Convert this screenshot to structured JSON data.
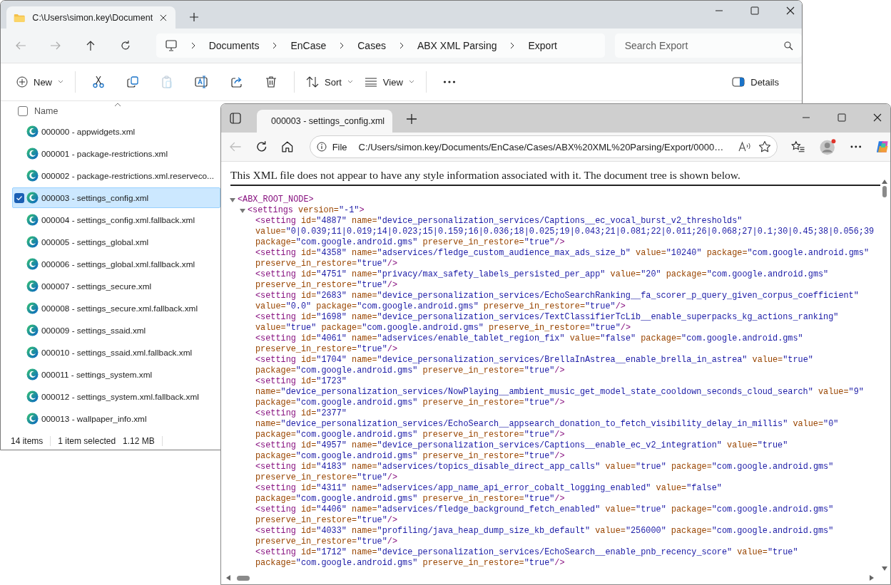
{
  "explorer": {
    "tab_title": "C:\\Users\\simon.key\\Document",
    "breadcrumb": [
      "Documents",
      "EnCase",
      "Cases",
      "ABX XML Parsing",
      "Export"
    ],
    "search": {
      "placeholder": "Search Export"
    },
    "toolbar": {
      "new": "New",
      "sort": "Sort",
      "view": "View",
      "details": "Details"
    },
    "column": "Name",
    "select_all": {
      "checked": false
    },
    "files": [
      {
        "name": "000000 - appwidgets.xml",
        "selected": false
      },
      {
        "name": "000001 - package-restrictions.xml",
        "selected": false
      },
      {
        "name": "000002 - package-restrictions.xml.reserveco...",
        "selected": false
      },
      {
        "name": "000003 - settings_config.xml",
        "selected": true
      },
      {
        "name": "000004 - settings_config.xml.fallback.xml",
        "selected": false
      },
      {
        "name": "000005 - settings_global.xml",
        "selected": false
      },
      {
        "name": "000006 - settings_global.xml.fallback.xml",
        "selected": false
      },
      {
        "name": "000007 - settings_secure.xml",
        "selected": false
      },
      {
        "name": "000008 - settings_secure.xml.fallback.xml",
        "selected": false
      },
      {
        "name": "000009 - settings_ssaid.xml",
        "selected": false
      },
      {
        "name": "000010 - settings_ssaid.xml.fallback.xml",
        "selected": false
      },
      {
        "name": "000011 - settings_system.xml",
        "selected": false
      },
      {
        "name": "000012 - settings_system.xml.fallback.xml",
        "selected": false
      },
      {
        "name": "000013 - wallpaper_info.xml",
        "selected": false
      }
    ],
    "status": {
      "count": "14 items",
      "selection": "1 item selected",
      "size": "1.12 MB"
    }
  },
  "browser": {
    "tab_title": "000003 - settings_config.xml",
    "address": {
      "scheme": "File",
      "url": "C:/Users/simon.key/Documents/EnCase/Cases/ABX%20XML%20Parsing/Export/0000…"
    },
    "notice": "This XML file does not appear to have any style information associated with it. The document tree is shown below.",
    "tree": {
      "tag": "<ABX_ROOT_NODE>",
      "expanded": true,
      "children": [
        {
          "tag": "<settings version=\"-1\">",
          "expanded": true,
          "children": [
            {
              "lines": [
                "<setting id=\"4887\" name=\"device_personalization_services/Captions__ec_vocal_burst_v2_thresholds\"",
                "value=\"0|0.039;11|0.019;14|0.023;15|0.159;16|0.036;18|0.025;19|0.043;21|0.081;22|0.011;26|0.068;27|0.1;30|0.45;38|0.056;39",
                "package=\"com.google.android.gms\" preserve_in_restore=\"true\"/>"
              ]
            },
            {
              "lines": [
                "<setting id=\"4358\" name=\"adservices/fledge_custom_audience_max_ads_size_b\" value=\"10240\" package=\"com.google.android.gms\"",
                "preserve_in_restore=\"true\"/>"
              ]
            },
            {
              "lines": [
                "<setting id=\"4751\" name=\"privacy/max_safety_labels_persisted_per_app\" value=\"20\" package=\"com.google.android.gms\"",
                "preserve_in_restore=\"true\"/>"
              ]
            },
            {
              "lines": [
                "<setting id=\"2683\" name=\"device_personalization_services/EchoSearchRanking__fa_scorer_p_query_given_corpus_coefficient\"",
                "value=\"0.0\" package=\"com.google.android.gms\" preserve_in_restore=\"true\"/>"
              ]
            },
            {
              "lines": [
                "<setting id=\"1698\" name=\"device_personalization_services/TextClassifierTcLib__enable_superpacks_kg_actions_ranking\"",
                "value=\"true\" package=\"com.google.android.gms\" preserve_in_restore=\"true\"/>"
              ]
            },
            {
              "lines": [
                "<setting id=\"4061\" name=\"adservices/enable_tablet_region_fix\" value=\"false\" package=\"com.google.android.gms\"",
                "preserve_in_restore=\"true\"/>"
              ]
            },
            {
              "lines": [
                "<setting id=\"1704\" name=\"device_personalization_services/BrellaInAstrea__enable_brella_in_astrea\" value=\"true\"",
                "package=\"com.google.android.gms\" preserve_in_restore=\"true\"/>"
              ]
            },
            {
              "lines": [
                "<setting id=\"1723\"",
                "name=\"device_personalization_services/NowPlaying__ambient_music_get_model_state_cooldown_seconds_cloud_search\" value=\"9\"",
                "package=\"com.google.android.gms\" preserve_in_restore=\"true\"/>"
              ]
            },
            {
              "lines": [
                "<setting id=\"2377\"",
                "name=\"device_personalization_services/EchoSearch__appsearch_donation_to_fetch_visibility_delay_in_millis\" value=\"0\"",
                "package=\"com.google.android.gms\" preserve_in_restore=\"true\"/>"
              ]
            },
            {
              "lines": [
                "<setting id=\"4957\" name=\"device_personalization_services/Captions__enable_ec_v2_integration\" value=\"true\"",
                "package=\"com.google.android.gms\" preserve_in_restore=\"true\"/>"
              ]
            },
            {
              "lines": [
                "<setting id=\"4183\" name=\"adservices/topics_disable_direct_app_calls\" value=\"true\" package=\"com.google.android.gms\"",
                "preserve_in_restore=\"true\"/>"
              ]
            },
            {
              "lines": [
                "<setting id=\"4311\" name=\"adservices/app_name_api_error_cobalt_logging_enabled\" value=\"false\"",
                "package=\"com.google.android.gms\" preserve_in_restore=\"true\"/>"
              ]
            },
            {
              "lines": [
                "<setting id=\"4406\" name=\"adservices/fledge_background_fetch_enabled\" value=\"true\" package=\"com.google.android.gms\"",
                "preserve_in_restore=\"true\"/>"
              ]
            },
            {
              "lines": [
                "<setting id=\"4033\" name=\"profiling/java_heap_dump_size_kb_default\" value=\"256000\" package=\"com.google.android.gms\"",
                "preserve_in_restore=\"true\"/>"
              ]
            },
            {
              "lines": [
                "<setting id=\"1712\" name=\"device_personalization_services/EchoSearch__enable_pnb_recency_score\" value=\"true\"",
                "package=\"com.google.android.gms\" preserve_in_restore=\"true\"/>"
              ]
            }
          ]
        }
      ]
    }
  }
}
